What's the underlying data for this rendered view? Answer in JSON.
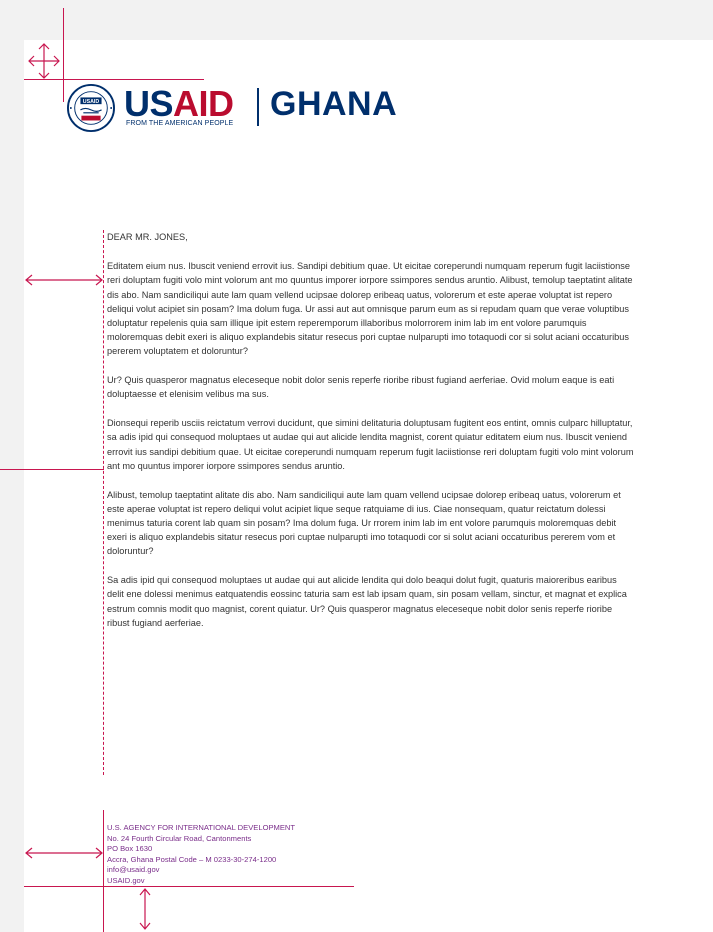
{
  "header": {
    "agency_word_us": "US",
    "agency_word_aid": "AID",
    "tagline": "FROM THE AMERICAN PEOPLE",
    "country": "GHANA",
    "seal_text_top": "UNITED STATES AGENCY",
    "seal_text_bottom": "INTERNATIONAL DEVELOPMENT",
    "seal_badge": "USAID"
  },
  "letter": {
    "salutation": "DEAR MR. JONES,",
    "paragraphs": [
      "Editatem eium nus. Ibuscit veniend errovit ius. Sandipi debitium quae. Ut eicitae coreperundi numquam reperum fugit laciistionse reri doluptam fugiti volo mint volorum ant mo quuntus imporer iorpore ssimpores sendus aruntio. Alibust, temolup taeptatint alitate dis abo. Nam sandiciliqui aute lam quam vellend ucipsae dolorep eribeaq uatus, volorerum et este aperae voluptat ist repero deliqui volut acipiet sin posam? Ima dolum fuga. Ur assi aut aut omnisque parum eum as si repudam quam que verae voluptibus doluptatur repelenis quia sam illique ipit estem reperemporum illaboribus molorrorem inim lab im ent volore parumquis moloremquas debit exeri is aliquo explandebis sitatur resecus pori cuptae nulparupti imo totaquodi cor si solut aciani occaturibus pererem voluptatem et doloruntur?",
      "Ur? Quis quasperor magnatus eleceseque nobit dolor senis reperfe rioribe ribust fugiand aerferiae. Ovid molum eaque is eati doluptaesse et elenisim velibus ma sus.",
      "Dionsequi reperib usciis reictatum verrovi ducidunt, que simini delitaturia doluptusam fugitent eos entint, omnis culparc hilluptatur, sa adis ipid qui consequod moluptaes ut audae qui aut alicide lendita magnist, corent quiatur editatem eium nus. Ibuscit veniend errovit ius sandipi debitium quae. Ut eicitae coreperundi numquam reperum fugit laciistionse reri doluptam fugiti volo mint volorum ant mo quuntus imporer iorpore ssimpores sendus aruntio.",
      "Alibust, temolup taeptatint alitate dis abo. Nam sandiciliqui aute lam quam vellend ucipsae dolorep eribeaq uatus, volorerum et este aperae voluptat ist repero deliqui volut acipiet lique seque ratquiame di ius. Ciae nonsequam, quatur reictatum dolessi menimus taturia corent lab quam sin posam? Ima dolum fuga. Ur rrorem inim lab im ent volore parumquis moloremquas debit exeri is aliquo explandebis sitatur resecus pori cuptae nulparupti imo totaquodi cor si solut aciani occaturibus pererem vom et doloruntur?",
      "Sa adis ipid qui consequod moluptaes ut audae qui aut alicide lendita qui dolo beaqui dolut fugit, quaturis maioreribus earibus delit ene dolessi menimus eatquatendis eossinc taturia sam est lab ipsam quam, sin posam vellam, sinctur, et magnat et explica estrum comnis modit quo magnist, corent quiatur. Ur? Quis quasperor magnatus eleceseque nobit dolor senis reperfe rioribe ribust fugiand aerferiae."
    ]
  },
  "footer": {
    "agency": "U.S. AGENCY FOR INTERNATIONAL DEVELOPMENT",
    "address1": "No. 24 Fourth Circular Road, Cantonments",
    "address2": "PO Box 1630",
    "address3": "Accra, Ghana Postal Code – M 0233-30-274-1200",
    "email": "info@usaid.gov",
    "website": "USAID.gov"
  },
  "colors": {
    "guide": "#c8164f",
    "navy": "#002f6c",
    "red": "#ba0c2f",
    "footer_text": "#7a2e8a"
  }
}
